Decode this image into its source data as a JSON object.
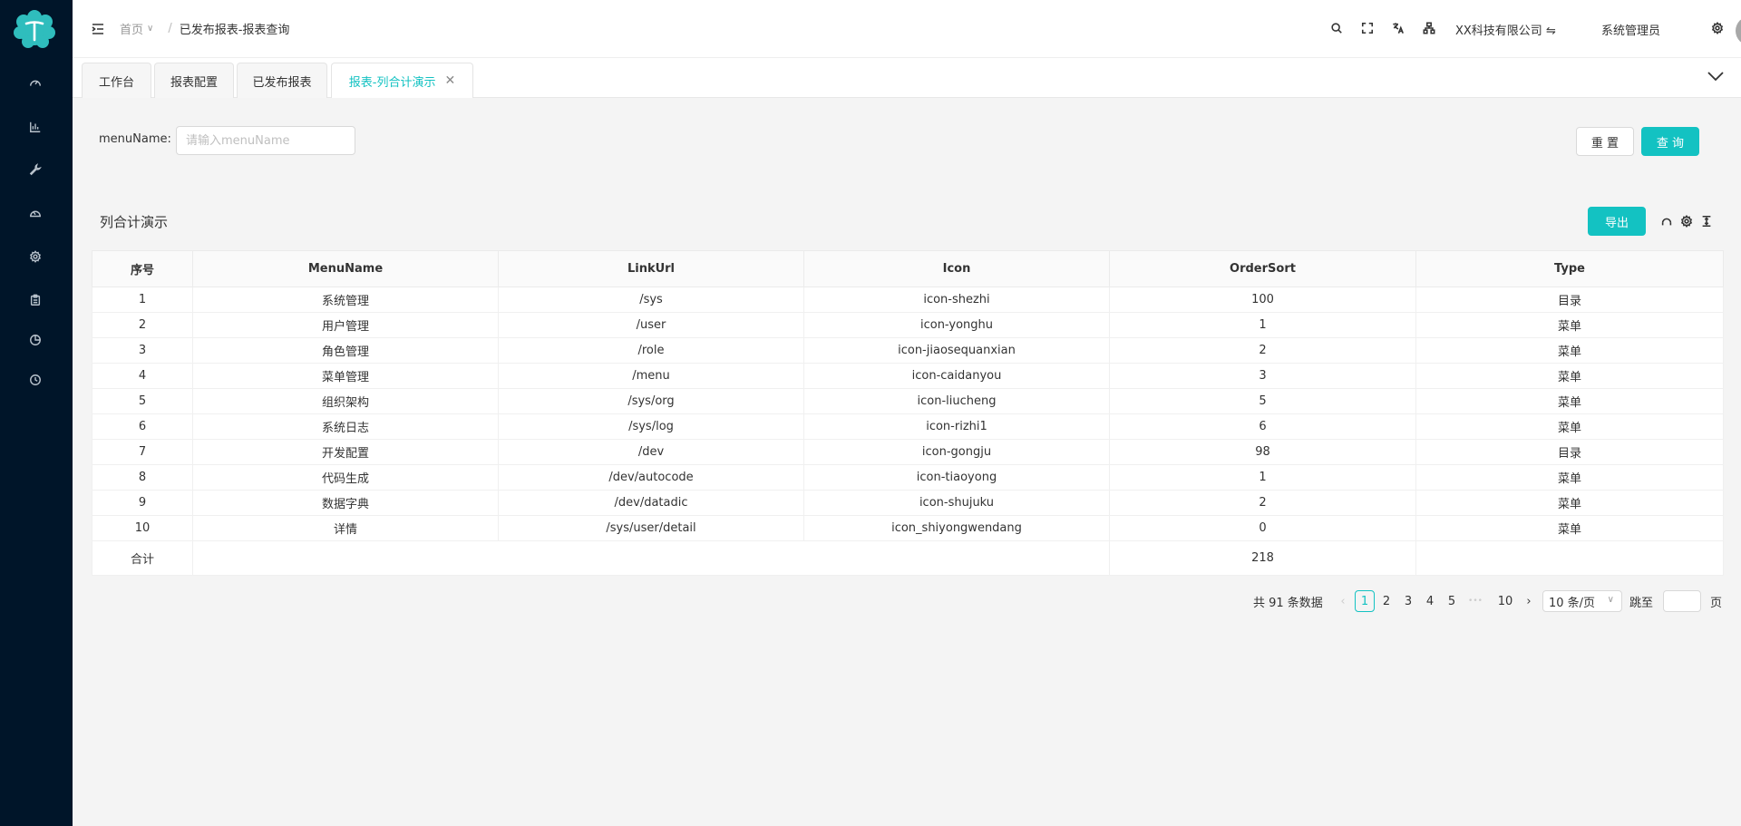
{
  "header": {
    "breadcrumb": {
      "home": "首页",
      "current": "已发布报表-报表查询"
    },
    "company": "XX科技有限公司 ⇋",
    "user": "系统管理员"
  },
  "tabs": [
    {
      "label": "工作台"
    },
    {
      "label": "报表配置"
    },
    {
      "label": "已发布报表"
    },
    {
      "label": "报表-列合计演示",
      "active": true
    }
  ],
  "search": {
    "label": "menuName:",
    "placeholder": "请输入menuName",
    "reset_label": "重 置",
    "query_label": "查 询"
  },
  "table": {
    "title": "列合计演示",
    "export_label": "导出",
    "columns": [
      "序号",
      "MenuName",
      "LinkUrl",
      "Icon",
      "OrderSort",
      "Type"
    ],
    "rows": [
      [
        "1",
        "系统管理",
        "/sys",
        "icon-shezhi",
        "100",
        "目录"
      ],
      [
        "2",
        "用户管理",
        "/user",
        "icon-yonghu",
        "1",
        "菜单"
      ],
      [
        "3",
        "角色管理",
        "/role",
        "icon-jiaosequanxian",
        "2",
        "菜单"
      ],
      [
        "4",
        "菜单管理",
        "/menu",
        "icon-caidanyou",
        "3",
        "菜单"
      ],
      [
        "5",
        "组织架构",
        "/sys/org",
        "icon-liucheng",
        "5",
        "菜单"
      ],
      [
        "6",
        "系统日志",
        "/sys/log",
        "icon-rizhi1",
        "6",
        "菜单"
      ],
      [
        "7",
        "开发配置",
        "/dev",
        "icon-gongju",
        "98",
        "目录"
      ],
      [
        "8",
        "代码生成",
        "/dev/autocode",
        "icon-tiaoyong",
        "1",
        "菜单"
      ],
      [
        "9",
        "数据字典",
        "/dev/datadic",
        "icon-shujuku",
        "2",
        "菜单"
      ],
      [
        "10",
        "详情",
        "/sys/user/detail",
        "icon_shiyongwendang",
        "0",
        "菜单"
      ]
    ],
    "summary": {
      "label": "合计",
      "order_sort_total": "218"
    }
  },
  "pagination": {
    "total_text": "共 91 条数据",
    "pages": [
      "1",
      "2",
      "3",
      "4",
      "5"
    ],
    "ellipsis": "•••",
    "last_page": "10",
    "current": "1",
    "page_size": "10 条/页",
    "jump_label": "跳至",
    "page_suffix": "页"
  },
  "colors": {
    "accent": "#13c2c2",
    "sidebar": "#001529"
  }
}
